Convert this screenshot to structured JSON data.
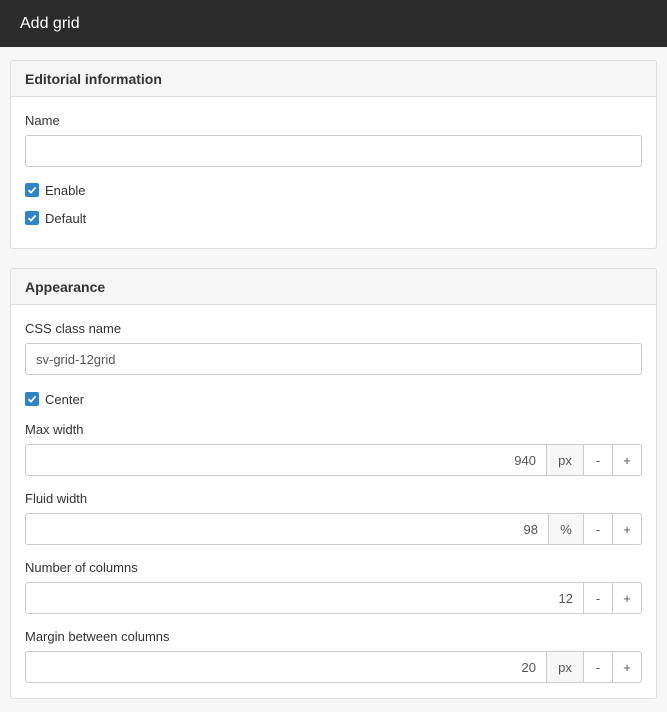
{
  "window": {
    "title": "Add grid"
  },
  "editorial": {
    "heading": "Editorial information",
    "name_label": "Name",
    "name_value": "",
    "enable_label": "Enable",
    "enable_checked": true,
    "default_label": "Default",
    "default_checked": true
  },
  "appearance": {
    "heading": "Appearance",
    "css_class_label": "CSS class name",
    "css_class_value": "sv-grid-12grid",
    "center_label": "Center",
    "center_checked": true,
    "max_width": {
      "label": "Max width",
      "value": "940",
      "unit": "px",
      "minus": "-",
      "plus": "+"
    },
    "fluid_width": {
      "label": "Fluid width",
      "value": "98",
      "unit": "%",
      "minus": "-",
      "plus": "+"
    },
    "columns": {
      "label": "Number of columns",
      "value": "12",
      "minus": "-",
      "plus": "+"
    },
    "margin": {
      "label": "Margin between columns",
      "value": "20",
      "unit": "px",
      "minus": "-",
      "plus": "+"
    }
  },
  "colors": {
    "titlebar": "#2b2b2b",
    "checkbox": "#2d85c8",
    "panel_heading": "#f5f5f5"
  }
}
